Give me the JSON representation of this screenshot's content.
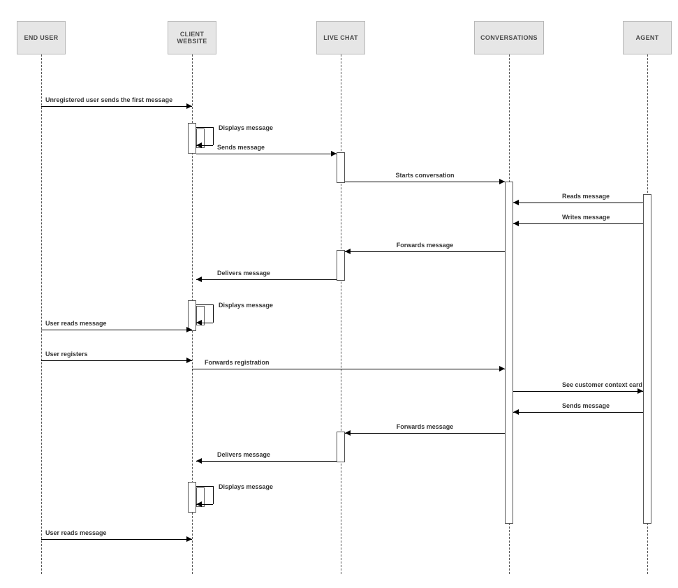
{
  "diagram": {
    "type": "uml-sequence",
    "title": "",
    "participants": [
      {
        "id": "end_user",
        "label": "END USER"
      },
      {
        "id": "client_website",
        "label": "CLIENT WEBSITE"
      },
      {
        "id": "live_chat",
        "label": "LIVE CHAT"
      },
      {
        "id": "conversations",
        "label": "CONVERSATIONS"
      },
      {
        "id": "agent",
        "label": "AGENT"
      }
    ],
    "messages": [
      {
        "from": "end_user",
        "to": "client_website",
        "text": "Unregistered user sends the first message",
        "kind": "sync"
      },
      {
        "from": "client_website",
        "to": "client_website",
        "text": "Displays message",
        "kind": "self"
      },
      {
        "from": "client_website",
        "to": "live_chat",
        "text": "Sends message",
        "kind": "sync"
      },
      {
        "from": "live_chat",
        "to": "conversations",
        "text": "Starts conversation",
        "kind": "sync"
      },
      {
        "from": "agent",
        "to": "conversations",
        "text": "Reads message",
        "kind": "sync"
      },
      {
        "from": "agent",
        "to": "conversations",
        "text": "Writes message",
        "kind": "sync"
      },
      {
        "from": "conversations",
        "to": "live_chat",
        "text": "Forwards message",
        "kind": "sync"
      },
      {
        "from": "live_chat",
        "to": "client_website",
        "text": "Delivers message",
        "kind": "sync"
      },
      {
        "from": "client_website",
        "to": "client_website",
        "text": "Displays message",
        "kind": "self"
      },
      {
        "from": "end_user",
        "to": "client_website",
        "text": "User reads message",
        "kind": "sync"
      },
      {
        "from": "end_user",
        "to": "client_website",
        "text": "User registers",
        "kind": "sync"
      },
      {
        "from": "client_website",
        "to": "conversations",
        "text": "Forwards registration",
        "kind": "sync"
      },
      {
        "from": "conversations",
        "to": "agent",
        "text": "See customer context card",
        "kind": "sync"
      },
      {
        "from": "agent",
        "to": "conversations",
        "text": "Sends message",
        "kind": "sync"
      },
      {
        "from": "conversations",
        "to": "live_chat",
        "text": "Forwards message",
        "kind": "sync"
      },
      {
        "from": "live_chat",
        "to": "client_website",
        "text": "Delivers message",
        "kind": "sync"
      },
      {
        "from": "client_website",
        "to": "client_website",
        "text": "Displays message",
        "kind": "self"
      },
      {
        "from": "end_user",
        "to": "client_website",
        "text": "User reads message",
        "kind": "sync"
      }
    ]
  }
}
